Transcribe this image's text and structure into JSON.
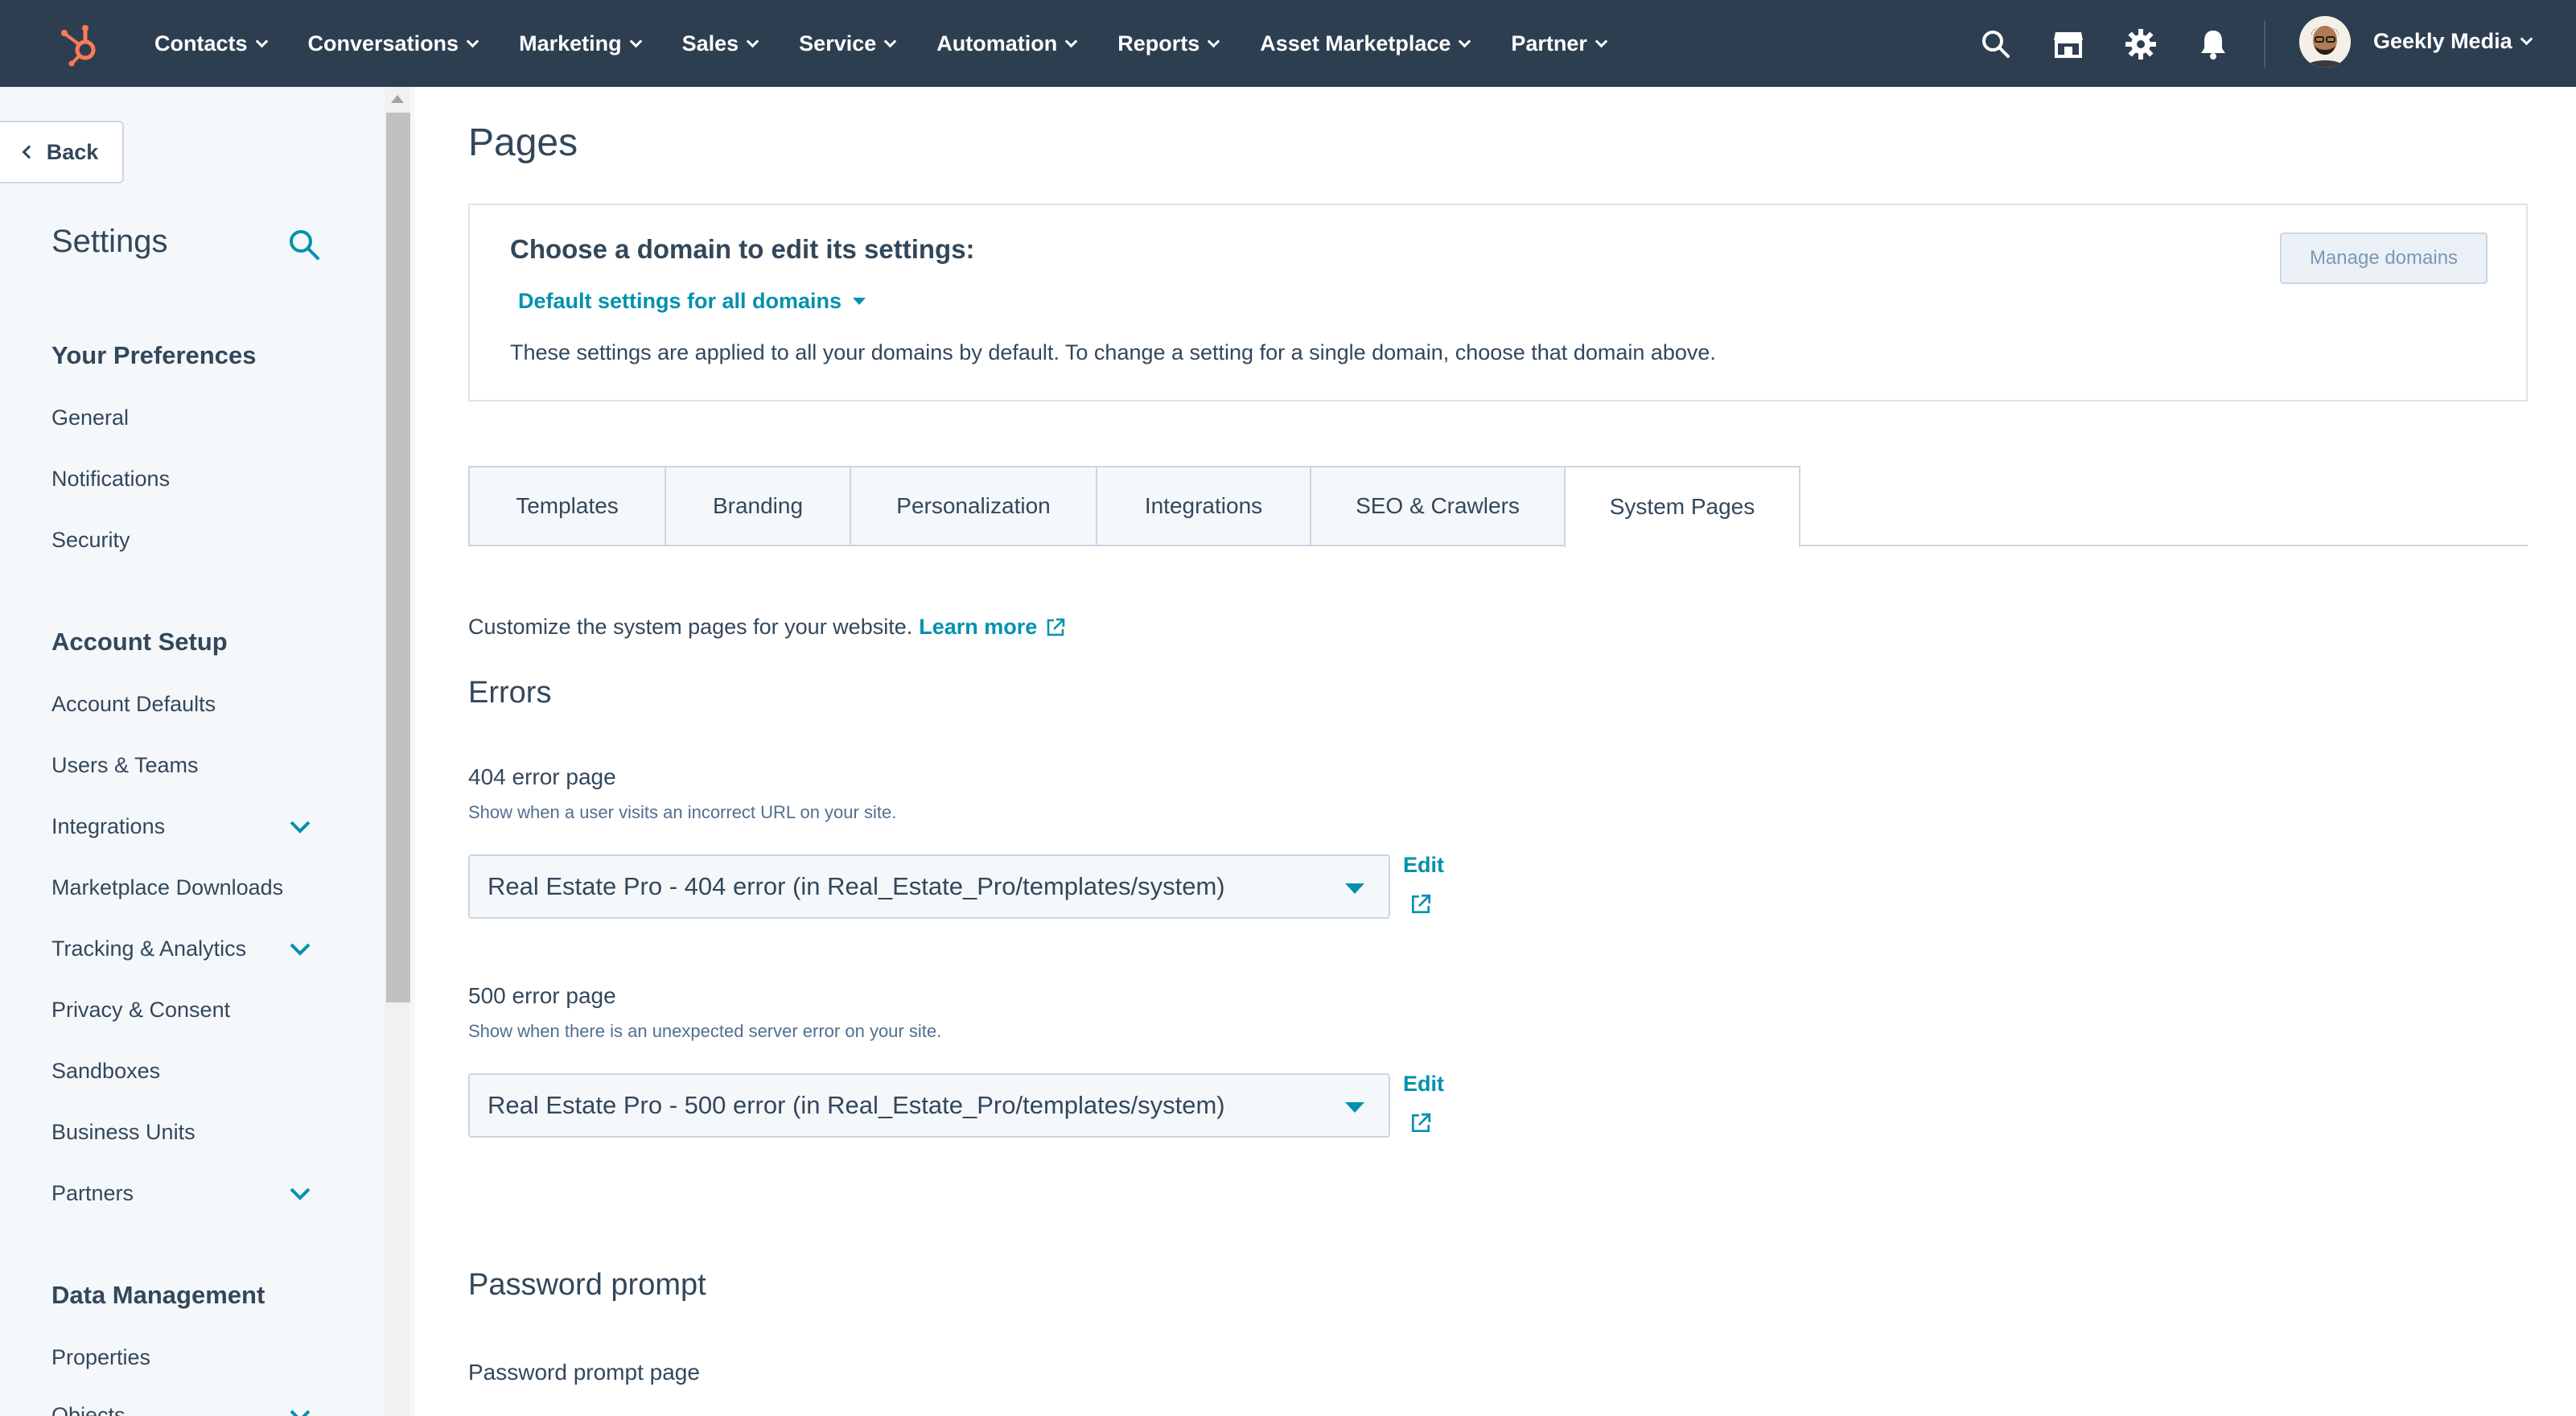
{
  "topnav": {
    "items": [
      {
        "label": "Contacts"
      },
      {
        "label": "Conversations"
      },
      {
        "label": "Marketing"
      },
      {
        "label": "Sales"
      },
      {
        "label": "Service"
      },
      {
        "label": "Automation"
      },
      {
        "label": "Reports"
      },
      {
        "label": "Asset Marketplace"
      },
      {
        "label": "Partner"
      }
    ],
    "account_name": "Geekly Media",
    "icons": [
      "search-icon",
      "marketplace-icon",
      "gear-icon",
      "bell-icon"
    ],
    "accent_color": "#ff7a59",
    "background_color": "#2d3e50"
  },
  "sidebar": {
    "back_label": "Back",
    "title": "Settings",
    "sections": [
      {
        "title": "Your Preferences",
        "items": [
          {
            "label": "General"
          },
          {
            "label": "Notifications"
          },
          {
            "label": "Security"
          }
        ]
      },
      {
        "title": "Account Setup",
        "items": [
          {
            "label": "Account Defaults"
          },
          {
            "label": "Users & Teams"
          },
          {
            "label": "Integrations"
          },
          {
            "label": "Marketplace Downloads"
          },
          {
            "label": "Tracking & Analytics"
          },
          {
            "label": "Privacy & Consent"
          },
          {
            "label": "Sandboxes"
          },
          {
            "label": "Business Units"
          },
          {
            "label": "Partners"
          }
        ]
      },
      {
        "title": "Data Management",
        "items": [
          {
            "label": "Properties"
          },
          {
            "label": "Objects"
          }
        ]
      }
    ]
  },
  "main": {
    "title": "Pages",
    "domain": {
      "label": "Choose a domain to edit its settings:",
      "selected": "Default settings for all domains",
      "description": "These settings are applied to all your domains by default. To change a setting for a single domain, choose that domain above.",
      "manage_button": "Manage domains"
    },
    "tabs": [
      {
        "label": "Templates"
      },
      {
        "label": "Branding"
      },
      {
        "label": "Personalization"
      },
      {
        "label": "Integrations"
      },
      {
        "label": "SEO & Crawlers"
      },
      {
        "label": "System Pages",
        "active": true
      }
    ],
    "intro": "Customize the system pages for your website.",
    "learn_more": "Learn more",
    "errors_heading": "Errors",
    "error404": {
      "label": "404 error page",
      "help": "Show when a user visits an incorrect URL on your site.",
      "value": "Real Estate Pro - 404 error (in Real_Estate_Pro/templates/system)",
      "edit": "Edit"
    },
    "error500": {
      "label": "500 error page",
      "help": "Show when there is an unexpected server error on your site.",
      "value": "Real Estate Pro - 500 error (in Real_Estate_Pro/templates/system)",
      "edit": "Edit"
    },
    "password_heading": "Password prompt",
    "password_label": "Password prompt page",
    "link_color": "#0091ae"
  }
}
